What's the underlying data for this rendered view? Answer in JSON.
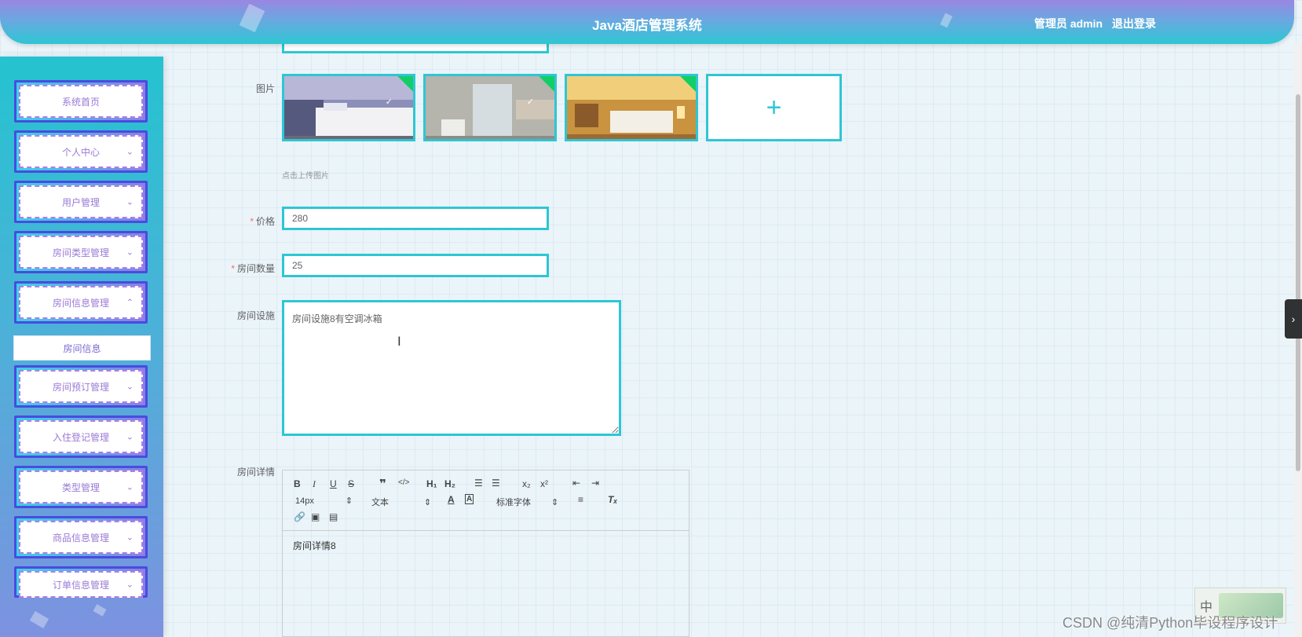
{
  "header": {
    "title": "Java酒店管理系统",
    "user_label": "管理员 admin",
    "logout_label": "退出登录"
  },
  "sidebar": {
    "items": [
      {
        "label": "系统首页",
        "has_chevron": false
      },
      {
        "label": "个人中心",
        "has_chevron": true,
        "chevron": "⌄"
      },
      {
        "label": "用户管理",
        "has_chevron": true,
        "chevron": "⌄"
      },
      {
        "label": "房间类型管理",
        "has_chevron": true,
        "chevron": "⌄"
      },
      {
        "label": "房间信息管理",
        "has_chevron": true,
        "chevron": "⌃"
      },
      {
        "label": "房间预订管理",
        "has_chevron": true,
        "chevron": "⌄"
      },
      {
        "label": "入住登记管理",
        "has_chevron": true,
        "chevron": "⌄"
      },
      {
        "label": "类型管理",
        "has_chevron": true,
        "chevron": "⌄"
      },
      {
        "label": "商品信息管理",
        "has_chevron": true,
        "chevron": "⌄"
      },
      {
        "label": "订单信息管理",
        "has_chevron": true,
        "chevron": "⌄"
      }
    ],
    "sub_item": "房间信息"
  },
  "form": {
    "image_label": "图片",
    "upload_hint": "点击上传图片",
    "add_icon": "+",
    "price_label": "价格",
    "price_value": "280",
    "room_count_label": "房间数量",
    "room_count_value": "25",
    "facilities_label": "房间设施",
    "facilities_value": "房间设施8有空调冰箱",
    "details_label": "房间详情",
    "required_mark": "*"
  },
  "editor": {
    "font_size": "14px",
    "paragraph": "文本",
    "font_family": "标准字体",
    "content": "房间详情8",
    "toolbar_icons": [
      "bold-icon",
      "italic-icon",
      "underline-icon",
      "strike-icon",
      "blockquote-icon",
      "code-icon",
      "h1-icon",
      "h2-icon",
      "ordered-list-icon",
      "bullet-list-icon",
      "subscript-icon",
      "superscript-icon",
      "outdent-icon",
      "indent-icon",
      "font-color-icon",
      "background-color-icon",
      "align-icon",
      "clear-format-icon",
      "link-icon",
      "image-icon",
      "video-icon"
    ]
  },
  "ime": {
    "label": "中"
  },
  "watermark": "CSDN @纯清Python毕设程序设计",
  "colors": {
    "accent": "#2ec6d4",
    "menu_text": "#9b79d6",
    "required": "#f56c6c"
  }
}
